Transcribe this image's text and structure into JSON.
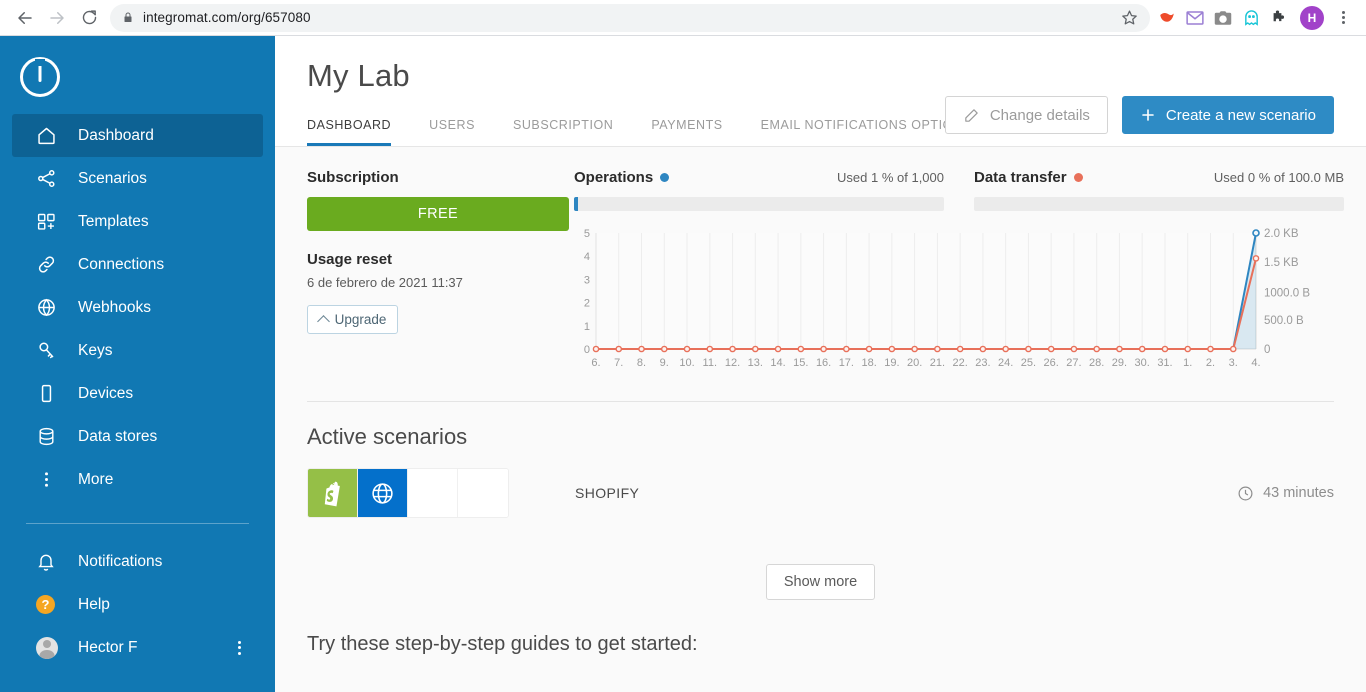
{
  "browser": {
    "url": "integromat.com/org/657080",
    "back_icon": "back-arrow-icon",
    "forward_icon": "forward-arrow-icon",
    "reload_icon": "reload-icon",
    "lock_icon": "lock-icon",
    "star_icon": "star-icon",
    "profile_initial": "H",
    "extensions": [
      {
        "name": "pocket-extension-icon",
        "color": "#ee4b2b"
      },
      {
        "name": "mail-extension-icon",
        "color": "#9b7fd4"
      },
      {
        "name": "screenshot-extension-icon",
        "color": "#8a8a8a"
      },
      {
        "name": "ghost-extension-icon",
        "color": "#18c5d6"
      },
      {
        "name": "puzzle-extensions-icon",
        "color": "#3c4043"
      }
    ]
  },
  "sidebar": {
    "logo": "integromat-logo",
    "items": [
      {
        "label": "Dashboard",
        "icon": "home-icon",
        "active": true
      },
      {
        "label": "Scenarios",
        "icon": "share-nodes-icon",
        "active": false
      },
      {
        "label": "Templates",
        "icon": "templates-icon",
        "active": false
      },
      {
        "label": "Connections",
        "icon": "link-icon",
        "active": false
      },
      {
        "label": "Webhooks",
        "icon": "globe-icon",
        "active": false
      },
      {
        "label": "Keys",
        "icon": "key-icon",
        "active": false
      },
      {
        "label": "Devices",
        "icon": "device-icon",
        "active": false
      },
      {
        "label": "Data stores",
        "icon": "database-icon",
        "active": false
      },
      {
        "label": "More",
        "icon": "more-vertical-icon",
        "active": false
      }
    ],
    "bottom_items": [
      {
        "label": "Notifications",
        "icon": "bell-icon"
      },
      {
        "label": "Help",
        "icon": "help-circle-icon"
      },
      {
        "label": "Hector F",
        "icon": "user-avatar-icon"
      }
    ],
    "background_color": "#1178b3",
    "active_color": "#0d6294"
  },
  "header": {
    "title": "My Lab",
    "change_details_label": "Change details",
    "change_details_icon": "edit-pencil-icon",
    "create_scenario_label": "Create a new scenario",
    "create_scenario_icon": "plus-icon",
    "primary_color": "#2e8bc5"
  },
  "tabs": [
    {
      "label": "DASHBOARD",
      "active": true
    },
    {
      "label": "USERS",
      "active": false
    },
    {
      "label": "SUBSCRIPTION",
      "active": false
    },
    {
      "label": "PAYMENTS",
      "active": false
    },
    {
      "label": "EMAIL NOTIFICATIONS OPTIONS",
      "active": false
    }
  ],
  "subscription": {
    "title": "Subscription",
    "plan": "FREE",
    "plan_color": "#6aab1f",
    "usage_reset_title": "Usage reset",
    "usage_reset_date": "6 de febrero de 2021 11:37",
    "upgrade_label": "Upgrade",
    "upgrade_icon": "chevron-up-icon"
  },
  "metrics": {
    "operations": {
      "title": "Operations",
      "dot_color": "#2e86c1",
      "used_text": "Used 1 % of 1,000",
      "percent": 1
    },
    "data_transfer": {
      "title": "Data transfer",
      "dot_color": "#e8705a",
      "used_text": "Used 0 % of 100.0 MB",
      "percent": 0
    }
  },
  "chart_data": {
    "type": "line",
    "title": "",
    "xlabel": "",
    "ylabel": "",
    "grid": true,
    "legend_position": "none",
    "x": [
      "6.",
      "7.",
      "8.",
      "9.",
      "10.",
      "11.",
      "12.",
      "13.",
      "14.",
      "15.",
      "16.",
      "17.",
      "18.",
      "19.",
      "20.",
      "21.",
      "22.",
      "23.",
      "24.",
      "25.",
      "26.",
      "27.",
      "28.",
      "29.",
      "30.",
      "31.",
      "1.",
      "2.",
      "3.",
      "4."
    ],
    "y_left_ticks": [
      "0",
      "1",
      "2",
      "3",
      "4",
      "5"
    ],
    "ylim_left": [
      0,
      5
    ],
    "y_right_ticks": [
      "0",
      "500.0 B",
      "1000.0 B",
      "1.5 KB",
      "2.0 KB"
    ],
    "ylim_right": [
      0,
      2048
    ],
    "series": [
      {
        "name": "Operations",
        "color": "#2e86c1",
        "axis": "left",
        "values": [
          0,
          0,
          0,
          0,
          0,
          0,
          0,
          0,
          0,
          0,
          0,
          0,
          0,
          0,
          0,
          0,
          0,
          0,
          0,
          0,
          0,
          0,
          0,
          0,
          0,
          0,
          0,
          0,
          0,
          5
        ]
      },
      {
        "name": "Data transfer",
        "color": "#e8705a",
        "axis": "right",
        "values": [
          0,
          0,
          0,
          0,
          0,
          0,
          0,
          0,
          0,
          0,
          0,
          0,
          0,
          0,
          0,
          0,
          0,
          0,
          0,
          0,
          0,
          0,
          0,
          0,
          0,
          0,
          0,
          0,
          0,
          1600
        ]
      }
    ]
  },
  "active_scenarios": {
    "title": "Active scenarios",
    "rows": [
      {
        "name": "SHOPIFY",
        "apps": [
          "shopify-icon",
          "http-globe-icon",
          "empty-slot",
          "empty-slot"
        ],
        "time": "43 minutes",
        "time_icon": "clock-icon"
      }
    ],
    "show_more_label": "Show more"
  },
  "guides": {
    "title": "Try these step-by-step guides to get started:"
  }
}
